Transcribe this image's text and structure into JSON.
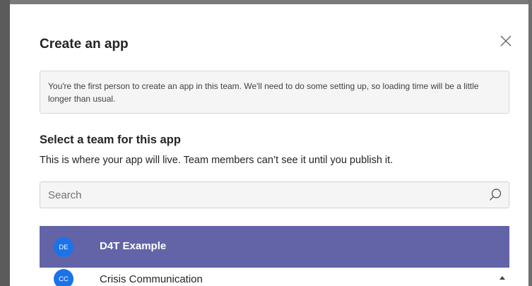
{
  "dialog": {
    "title": "Create an app",
    "close_icon": "close-icon",
    "notice": "You're the first person to create an app in this team. We'll need to do some setting up, so loading time will be a little longer than usual.",
    "section_title": "Select a team for this app",
    "section_description": "This is where your app will live. Team members can’t see it until you publish it.",
    "search": {
      "placeholder": "Search",
      "icon": "search-icon"
    },
    "teams": [
      {
        "initials": "DE",
        "name": "D4T Example",
        "selected": true
      },
      {
        "initials": "CC",
        "name": "Crisis Communication",
        "selected": false
      }
    ]
  },
  "colors": {
    "selected_row": "#6264a7",
    "avatar": "#1a73e8",
    "notice_bg": "#f5f5f5"
  }
}
